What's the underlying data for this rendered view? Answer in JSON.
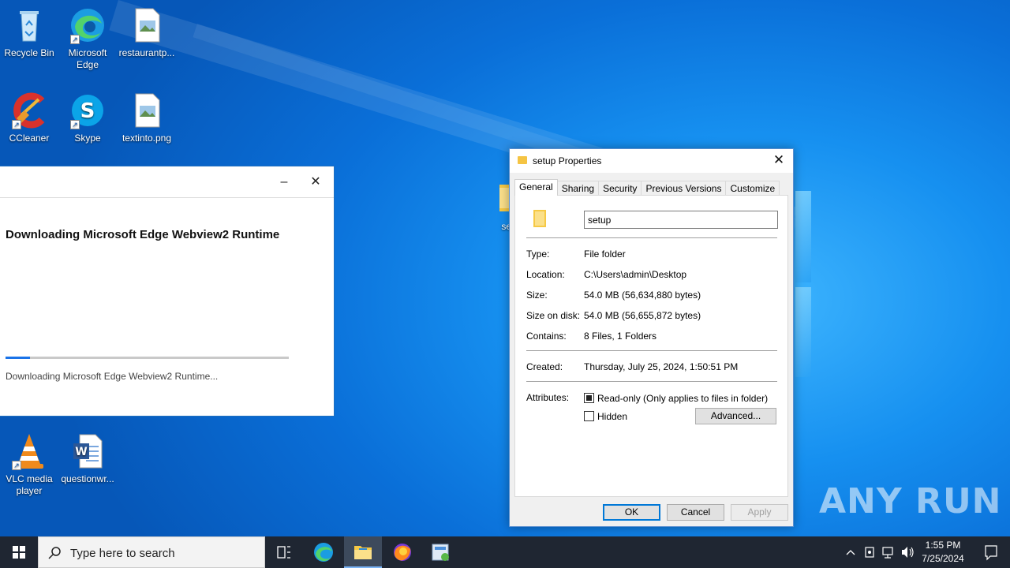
{
  "desktop": {
    "icons": [
      {
        "label": "Recycle Bin"
      },
      {
        "label": "Microsoft Edge"
      },
      {
        "label": "restaurantp..."
      },
      {
        "label": "CCleaner"
      },
      {
        "label": "Skype"
      },
      {
        "label": "textinto.png"
      },
      {
        "label": "VLC media player"
      },
      {
        "label": "questionwr..."
      },
      {
        "label": "setu"
      }
    ],
    "watermark": "ANY RUN"
  },
  "installer": {
    "minimize_glyph": "–",
    "close_glyph": "✕",
    "heading": "Downloading Microsoft Edge Webview2 Runtime",
    "progress": 0.085,
    "status": "Downloading Microsoft Edge Webview2 Runtime..."
  },
  "properties": {
    "title": "setup Properties",
    "close_glyph": "✕",
    "tabs": [
      "General",
      "Sharing",
      "Security",
      "Previous Versions",
      "Customize"
    ],
    "active_tab": "General",
    "name_value": "setup",
    "fields": {
      "type_label": "Type:",
      "type_value": "File folder",
      "location_label": "Location:",
      "location_value": "C:\\Users\\admin\\Desktop",
      "size_label": "Size:",
      "size_value": "54.0 MB (56,634,880 bytes)",
      "size_on_disk_label": "Size on disk:",
      "size_on_disk_value": "54.0 MB (56,655,872 bytes)",
      "contains_label": "Contains:",
      "contains_value": "8 Files, 1 Folders",
      "created_label": "Created:",
      "created_value": "Thursday, July 25, 2024, 1:50:51 PM",
      "attributes_label": "Attributes:"
    },
    "readonly_label": "Read-only (Only applies to files in folder)",
    "readonly_checked": true,
    "hidden_label": "Hidden",
    "hidden_checked": false,
    "advanced_button": "Advanced...",
    "ok_button": "OK",
    "cancel_button": "Cancel",
    "apply_button": "Apply"
  },
  "taskbar": {
    "search_placeholder": "Type here to search",
    "time": "1:55 PM",
    "date": "7/25/2024"
  },
  "colors": {
    "accent": "#0078d7",
    "taskbar": "#1f2632",
    "desktop": "#0a6fd8"
  }
}
